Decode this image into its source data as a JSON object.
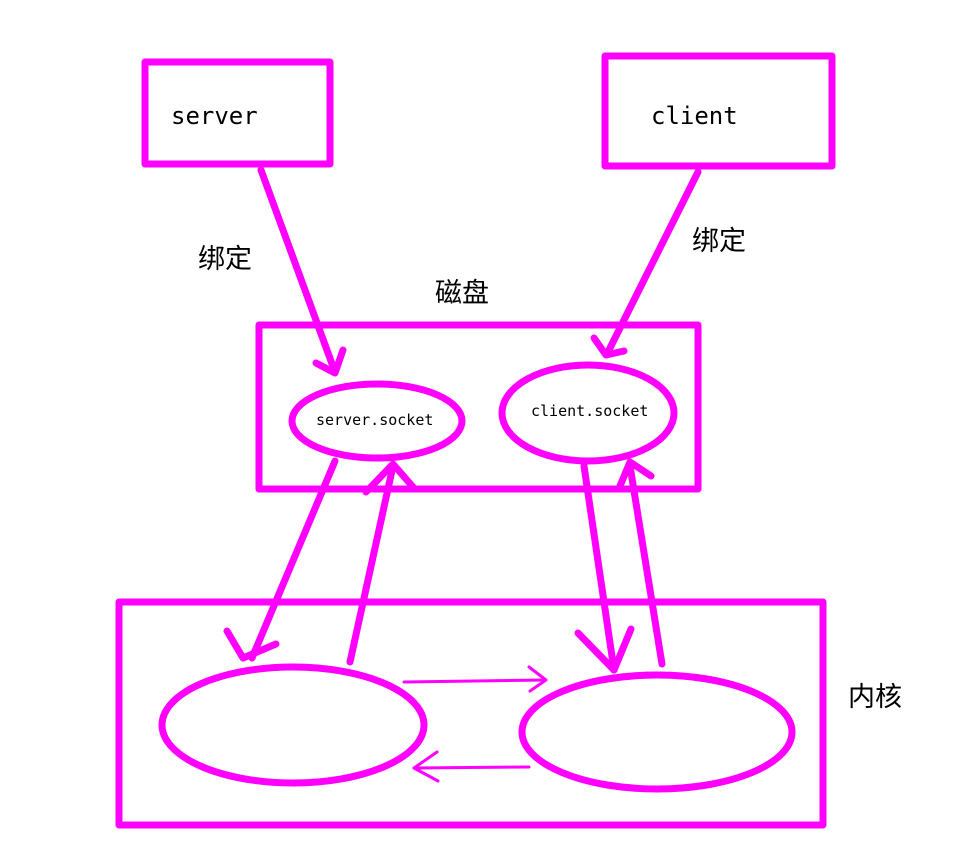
{
  "colors": {
    "accent": "#ff00ff",
    "text": "#000000",
    "background": "#ffffff"
  },
  "nodes": {
    "server": {
      "label": "server"
    },
    "client": {
      "label": "client"
    },
    "disk": {
      "label": "磁盘",
      "server_socket": "server.socket",
      "client_socket": "client.socket"
    },
    "kernel": {
      "label": "内核"
    }
  },
  "edges": {
    "server_bind": "绑定",
    "client_bind": "绑定"
  }
}
